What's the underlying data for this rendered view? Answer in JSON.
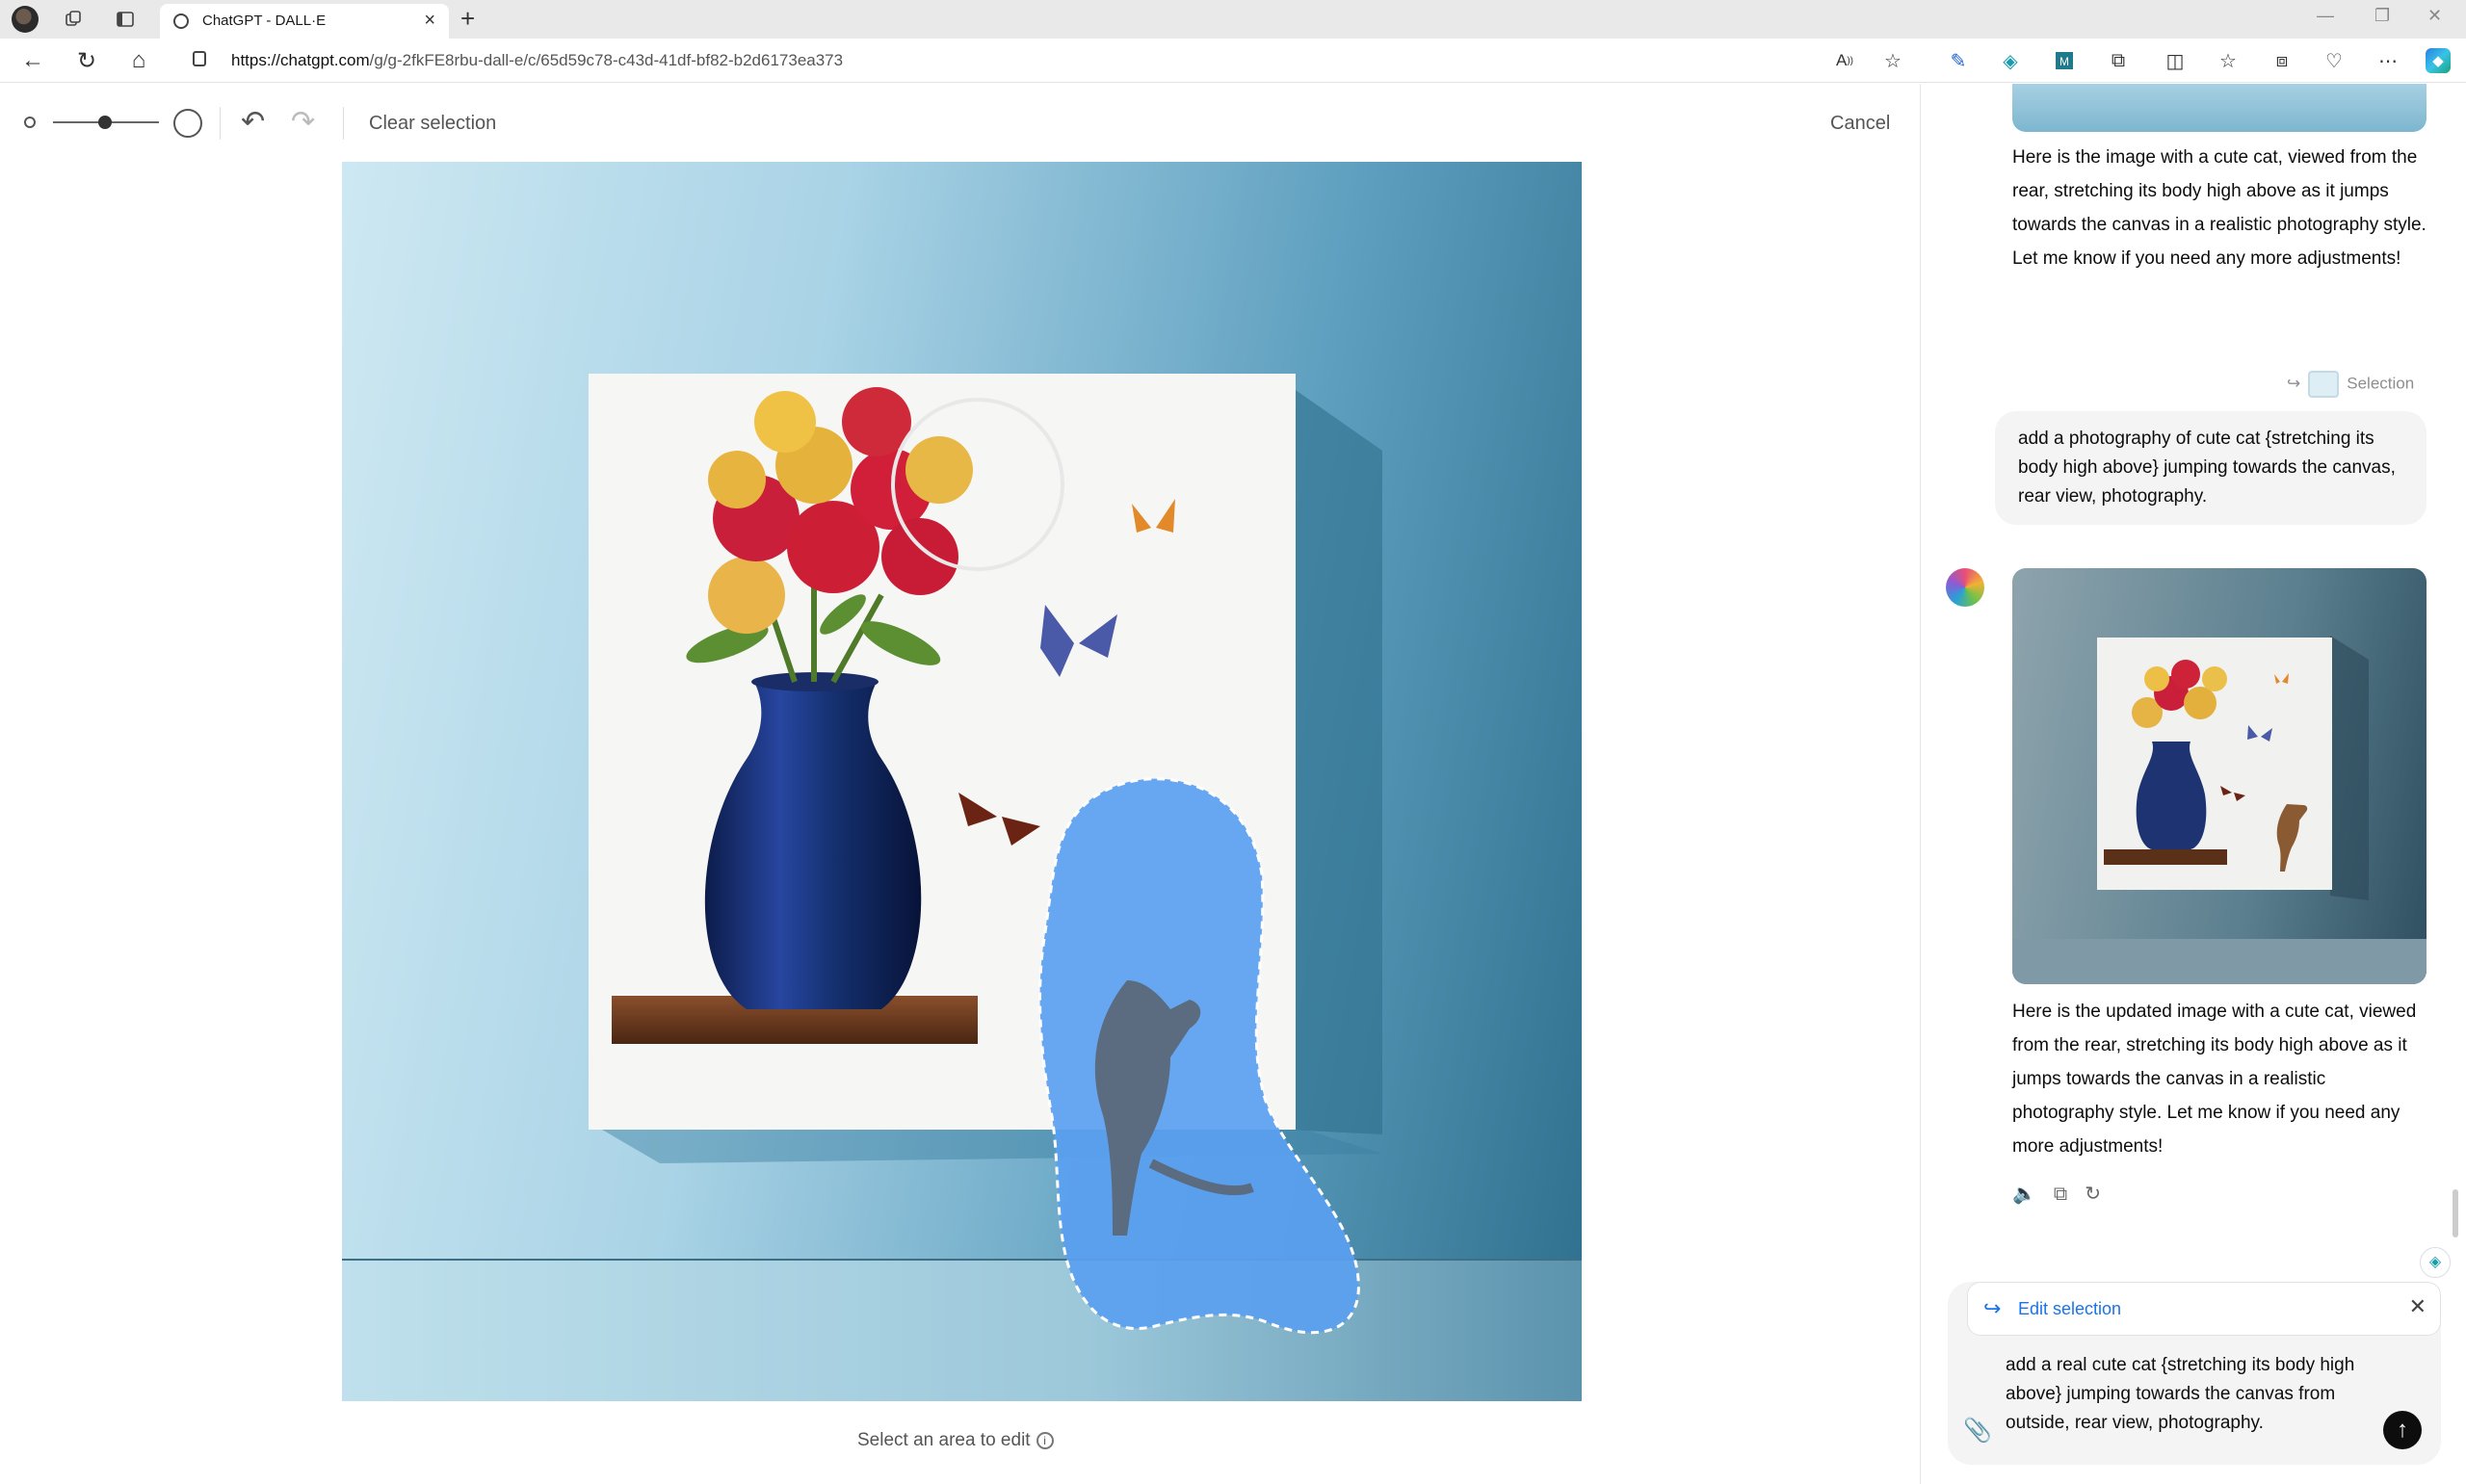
{
  "browser": {
    "tab_title": "ChatGPT - DALL·E",
    "url_host": "https://chatgpt.com",
    "url_path": "/g/g-2fkFE8rbu-dall-e/c/65d59c78-c43d-41df-bf82-b2d6173ea373",
    "icons": [
      "profile-avatar",
      "workspaces-icon",
      "tab-actions-icon",
      "back-icon",
      "refresh-icon",
      "home-icon",
      "lock-icon",
      "read-aloud-icon",
      "favorite-star-icon",
      "extension-icons",
      "split-screen-icon",
      "favorites-icon",
      "collections-icon",
      "browser-essentials-icon",
      "more-icon",
      "copilot-icon"
    ]
  },
  "editor": {
    "clear_selection": "Clear selection",
    "cancel": "Cancel",
    "hint": "Select an area to edit",
    "hint_icon": "i"
  },
  "chat": {
    "assistant_msg_1": "Here is the image with a cute cat, viewed from the rear, stretching its body high above as it jumps towards the canvas in a realistic photography style. Let me know if you need any more adjustments!",
    "selection_label": "Selection",
    "user_msg": "add a photography of cute cat {stretching its body high above} jumping towards the canvas, rear view, photography.",
    "assistant_msg_2": "Here is the updated image with a cute cat, viewed from the rear, stretching its body high above as it jumps towards the canvas in a realistic photography style. Let me know if you need any more adjustments!",
    "actions": [
      "read-aloud-icon",
      "copy-icon",
      "regenerate-icon"
    ]
  },
  "composer": {
    "edit_selection_label": "Edit selection",
    "text": "add a real cute cat {stretching its body high above} jumping towards the canvas from outside, rear view, photography."
  },
  "colors": {
    "accent_blue": "#1a73e8",
    "mask_blue": "#5aa0f0"
  }
}
